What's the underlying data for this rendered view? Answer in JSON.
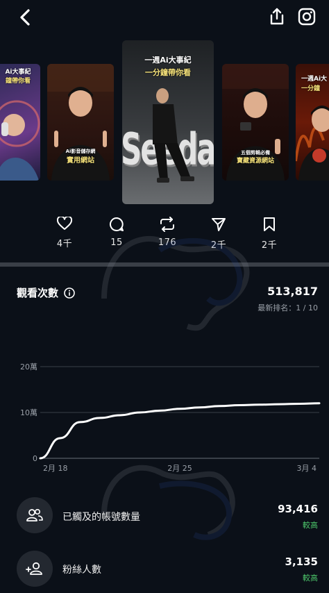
{
  "header": {
    "back_icon": "chevron-left-icon",
    "share_icon": "share-icon",
    "instagram_icon": "instagram-icon"
  },
  "carousel": {
    "thumbs": [
      {
        "lines": [
          "Ai大事紀",
          "鐘帶你看"
        ]
      },
      {
        "lines": [
          "Ai影音儲存網",
          "實用網站"
        ]
      },
      {
        "lines": [
          "一週Ai大事紀",
          "一分鐘帶你看"
        ],
        "scene_text": "Seedance"
      },
      {
        "lines": [
          "五個剪輯必備",
          "寶藏資源網站"
        ]
      },
      {
        "lines": [
          "一週Ai大",
          "一分鐘"
        ]
      }
    ]
  },
  "actions": [
    {
      "icon": "heart-icon",
      "count": "4千"
    },
    {
      "icon": "comment-icon",
      "count": "15"
    },
    {
      "icon": "repost-icon",
      "count": "176"
    },
    {
      "icon": "send-icon",
      "count": "2千"
    },
    {
      "icon": "bookmark-icon",
      "count": "2千"
    }
  ],
  "views": {
    "title": "觀看次數",
    "value": "513,817",
    "rank": "最新排名：1 / 10"
  },
  "chart_data": {
    "type": "line",
    "x": [
      "2月 18",
      "2月 19",
      "2月 20",
      "2月 21",
      "2月 22",
      "2月 23",
      "2月 24",
      "2月 25",
      "2月 26",
      "2月 27",
      "2月 28",
      "3月 1",
      "3月 2",
      "3月 3",
      "3月 4"
    ],
    "values": [
      0,
      4.4,
      7.9,
      8.8,
      9.4,
      10.0,
      10.4,
      10.8,
      11.1,
      11.4,
      11.6,
      11.7,
      11.8,
      11.9,
      12.0
    ],
    "x_ticks": [
      "2月 18",
      "2月 25",
      "3月 4"
    ],
    "y_ticks": [
      "0",
      "10萬",
      "20萬"
    ],
    "ylim": [
      0,
      20
    ],
    "grid": true,
    "color": "#ffffff"
  },
  "stats": [
    {
      "icon": "accounts-reached-icon",
      "label": "已觸及的帳號數量",
      "value": "93,416",
      "level": "較高"
    },
    {
      "icon": "add-follower-icon",
      "label": "粉絲人數",
      "value": "3,135",
      "level": "較高"
    }
  ]
}
